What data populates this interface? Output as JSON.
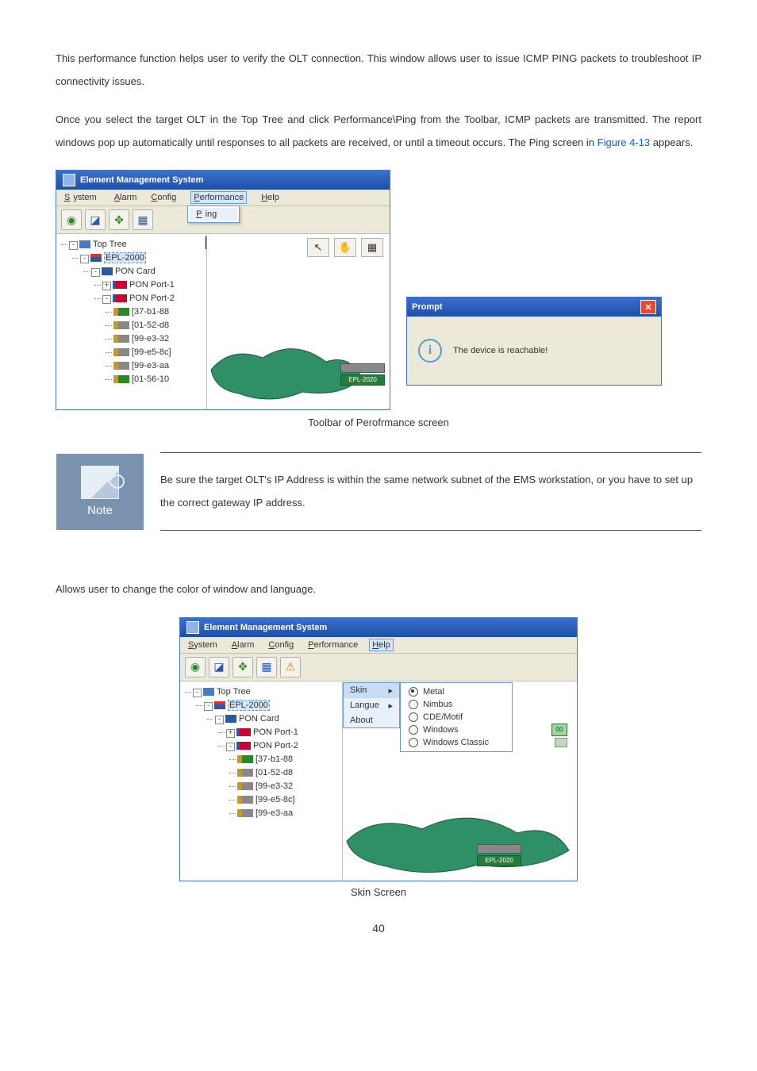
{
  "para1": "This performance function helps user to verify the OLT connection. This window allows user to issue ICMP PING packets to troubleshoot IP connectivity issues.",
  "para2_a": "Once you select the target OLT in the Top Tree and click Performance\\Ping from the Toolbar, ICMP packets are transmitted. The report windows pop up automatically until responses to all packets are received, or until a timeout occurs. The Ping screen in ",
  "para2_link": "Figure 4-13",
  "para2_b": " appears.",
  "ems": {
    "title": "Element Management System",
    "menu": {
      "system": "System",
      "alarm": "Alarm",
      "config": "Config",
      "performance": "Performance",
      "help": "Help"
    },
    "ping": "Ping",
    "tooltip": "ping",
    "tree": {
      "root": "Top Tree",
      "epl": "EPL-2000",
      "card": "PON Card",
      "port1": "PON Port-1",
      "port2": "PON Port-2",
      "onus": [
        "[37-b1-88",
        "[01-52-d8",
        "[99-e3-32",
        "[99-e5-8c]",
        "[99-e3-aa",
        "[01-56-10"
      ]
    },
    "devlabel": "EPL-2020"
  },
  "prompt": {
    "title": "Prompt",
    "msg": "The device is reachable!"
  },
  "caption1": "Toolbar of Perofrmance screen",
  "note": {
    "label": "Note",
    "text": "Be sure the target OLT's IP Address is within the same network subnet of the EMS workstation, or you have to set up the correct gateway IP address."
  },
  "para3": "Allows user to change the color of window and language.",
  "help": {
    "skin": "Skin",
    "langue": "Langue",
    "about": "About",
    "opts": {
      "metal": "Metal",
      "nimbus": "Nimbus",
      "cde": "CDE/Motif",
      "windows": "Windows",
      "classic": "Windows Classic"
    }
  },
  "ems2": {
    "onus": [
      "[37-b1-88",
      "[01-52-d8",
      "[99-e3-32",
      "[99-e5-8c]",
      "[99-e3-aa"
    ],
    "devlabel": "EPL-2020",
    "badge": "00"
  },
  "caption2": "Skin Screen",
  "pagenum": "40"
}
